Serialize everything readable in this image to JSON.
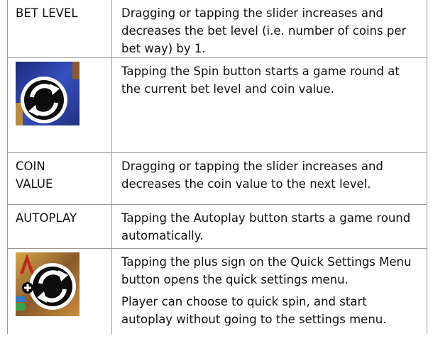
{
  "rows": [
    {
      "label": "BET LEVEL",
      "description": "Dragging or tapping the slider increases and decreases the bet level (i.e. number of coins per bet way) by 1."
    },
    {
      "icon": "spin-button-icon",
      "description": "Tapping the Spin button starts a game round at the current bet level and coin value."
    },
    {
      "label_line1": "COIN",
      "label_line2": "VALUE",
      "description": "Dragging or tapping the slider increases and decreases the coin value to the next level."
    },
    {
      "label": "AUTOPLAY",
      "description": "Tapping the Autoplay button starts a game round automatically."
    },
    {
      "icon": "quick-settings-spin-button-icon",
      "description": "Tapping the plus sign on the Quick Settings Menu button opens the quick settings menu.",
      "description2": "Player can choose to quick spin, and start autoplay without going to the settings menu."
    }
  ],
  "colors": {
    "border": "#9a9a9a",
    "text": "#111111",
    "icon_bg": "#2b3fa6"
  }
}
